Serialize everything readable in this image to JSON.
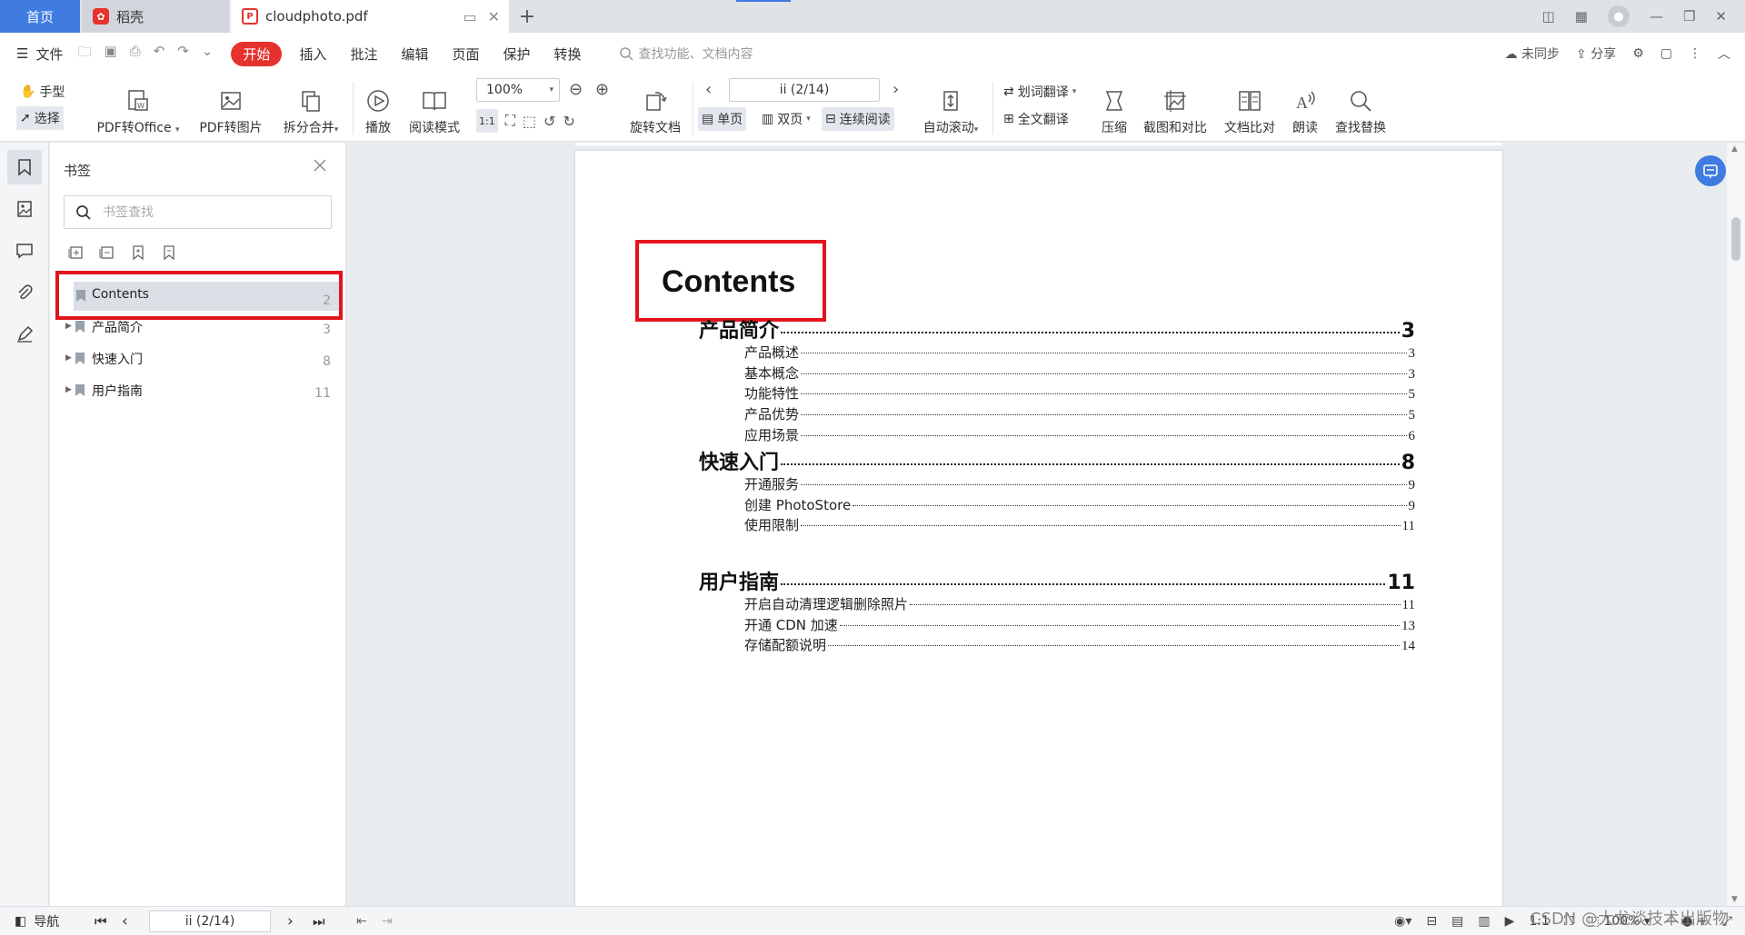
{
  "tabs": {
    "home": "首页",
    "daoke": "稻壳",
    "doc": "cloudphoto.pdf"
  },
  "menu": {
    "file": "文件",
    "tabs": [
      "开始",
      "插入",
      "批注",
      "编辑",
      "页面",
      "保护",
      "转换"
    ],
    "search_placeholder": "查找功能、文档内容",
    "unsynced": "未同步",
    "share": "分享"
  },
  "ribbon": {
    "hand": "手型",
    "select": "选择",
    "pdf_to_office": "PDF转Office",
    "pdf_to_image": "PDF转图片",
    "split_merge": "拆分合并",
    "play": "播放",
    "read_mode": "阅读模式",
    "zoom": "100%",
    "rotate": "旋转文档",
    "page_indicator": "ii (2/14)",
    "single_page": "单页",
    "double_page": "双页",
    "continuous": "连续阅读",
    "auto_scroll": "自动滚动",
    "word_translate": "划词翻译",
    "full_translate": "全文翻译",
    "compress": "压缩",
    "screenshot_compare": "截图和对比",
    "doc_compare": "文档比对",
    "read_aloud": "朗读",
    "find_replace": "查找替换"
  },
  "bookmark_panel": {
    "title": "书签",
    "search_placeholder": "书签查找",
    "items": [
      {
        "label": "Contents",
        "page": "2"
      },
      {
        "label": "产品简介",
        "page": "3"
      },
      {
        "label": "快速入门",
        "page": "8"
      },
      {
        "label": "用户指南",
        "page": "11"
      }
    ]
  },
  "document": {
    "heading": "Contents",
    "sections": [
      {
        "title": "产品简介",
        "page": "3",
        "items": [
          {
            "title": "产品概述",
            "page": "3"
          },
          {
            "title": "基本概念",
            "page": "3"
          },
          {
            "title": "功能特性",
            "page": "5"
          },
          {
            "title": "产品优势",
            "page": "5"
          },
          {
            "title": "应用场景",
            "page": "6"
          }
        ]
      },
      {
        "title": "快速入门",
        "page": "8",
        "items": [
          {
            "title": "开通服务",
            "page": "9"
          },
          {
            "title": "创建 PhotoStore",
            "page": "9"
          },
          {
            "title": "使用限制",
            "page": "11"
          }
        ]
      },
      {
        "title": "用户指南",
        "page": "11",
        "items": [
          {
            "title": "开启自动清理逻辑删除照片",
            "page": "11"
          },
          {
            "title": "开通 CDN 加速",
            "page": "13"
          },
          {
            "title": "存储配额说明",
            "page": "14"
          }
        ]
      }
    ]
  },
  "status": {
    "nav": "导航",
    "page_indicator": "ii (2/14)",
    "zoom": "100%",
    "watermark": "CSDN @大龙谈技术出版物"
  },
  "colors": {
    "accent": "#3f7be0",
    "brand_red": "#e5322d",
    "highlight": "#e3141d"
  }
}
